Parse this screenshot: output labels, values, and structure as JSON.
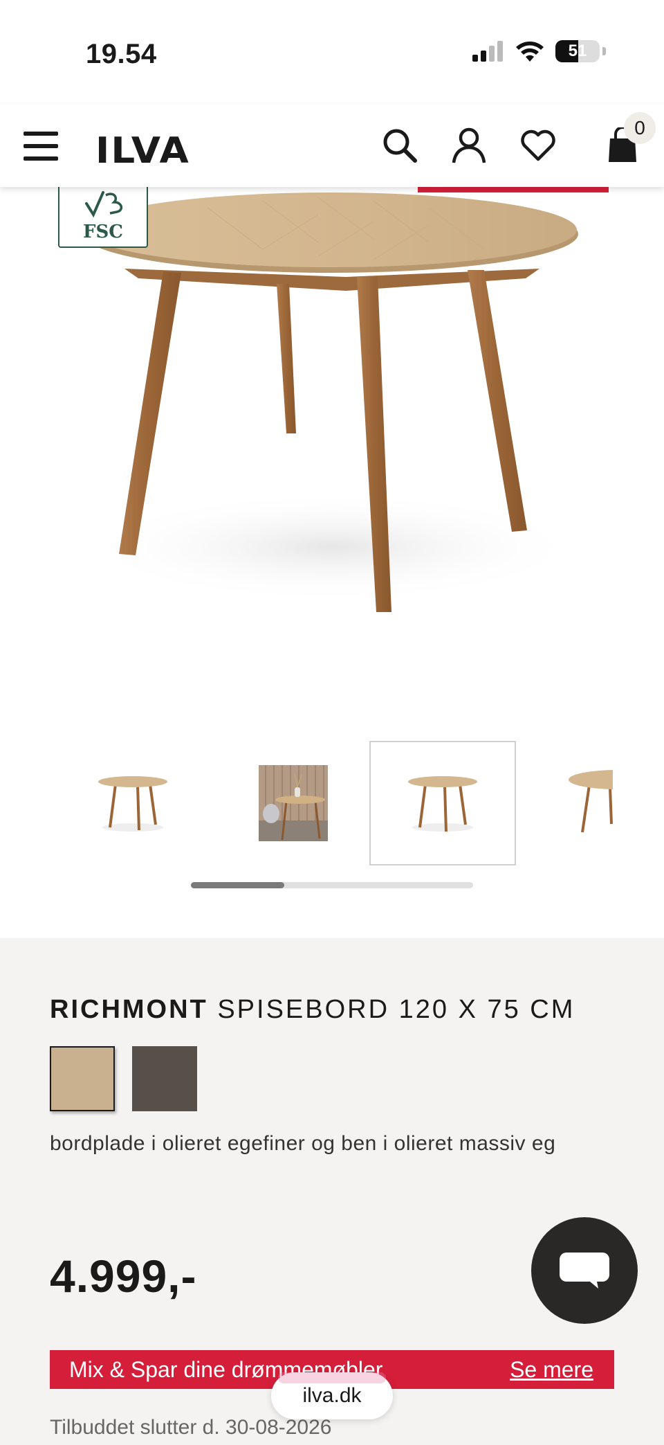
{
  "status_bar": {
    "time": "19.54",
    "battery_level": "51",
    "icons": [
      "signal-icon",
      "wifi-icon",
      "battery-icon"
    ]
  },
  "header": {
    "logo": "ILVA",
    "cart_count": "0",
    "icons": [
      "menu-icon",
      "search-icon",
      "account-icon",
      "heart-icon",
      "bag-icon"
    ],
    "accent_color": "#d51f3a"
  },
  "gallery": {
    "badge": "FSC",
    "thumbnail_count": 4,
    "selected_thumbnail": 3,
    "scroll_position": 0.33
  },
  "product": {
    "brand": "RICHMONT",
    "name": "SPISEBORD 120 X 75 CM",
    "swatches": [
      {
        "color": "#c9b08e",
        "selected": true
      },
      {
        "color": "#57504a",
        "selected": false
      }
    ],
    "description": "bordplade i olieret egefiner og ben i olieret massiv eg",
    "price": "4.999,-"
  },
  "promo": {
    "text": "Mix & Spar dine drømmemøbler",
    "link": "Se mere",
    "offer_end": "Tilbuddet slutter d. 30-08-2026"
  },
  "browser": {
    "url": "ilva.dk"
  }
}
